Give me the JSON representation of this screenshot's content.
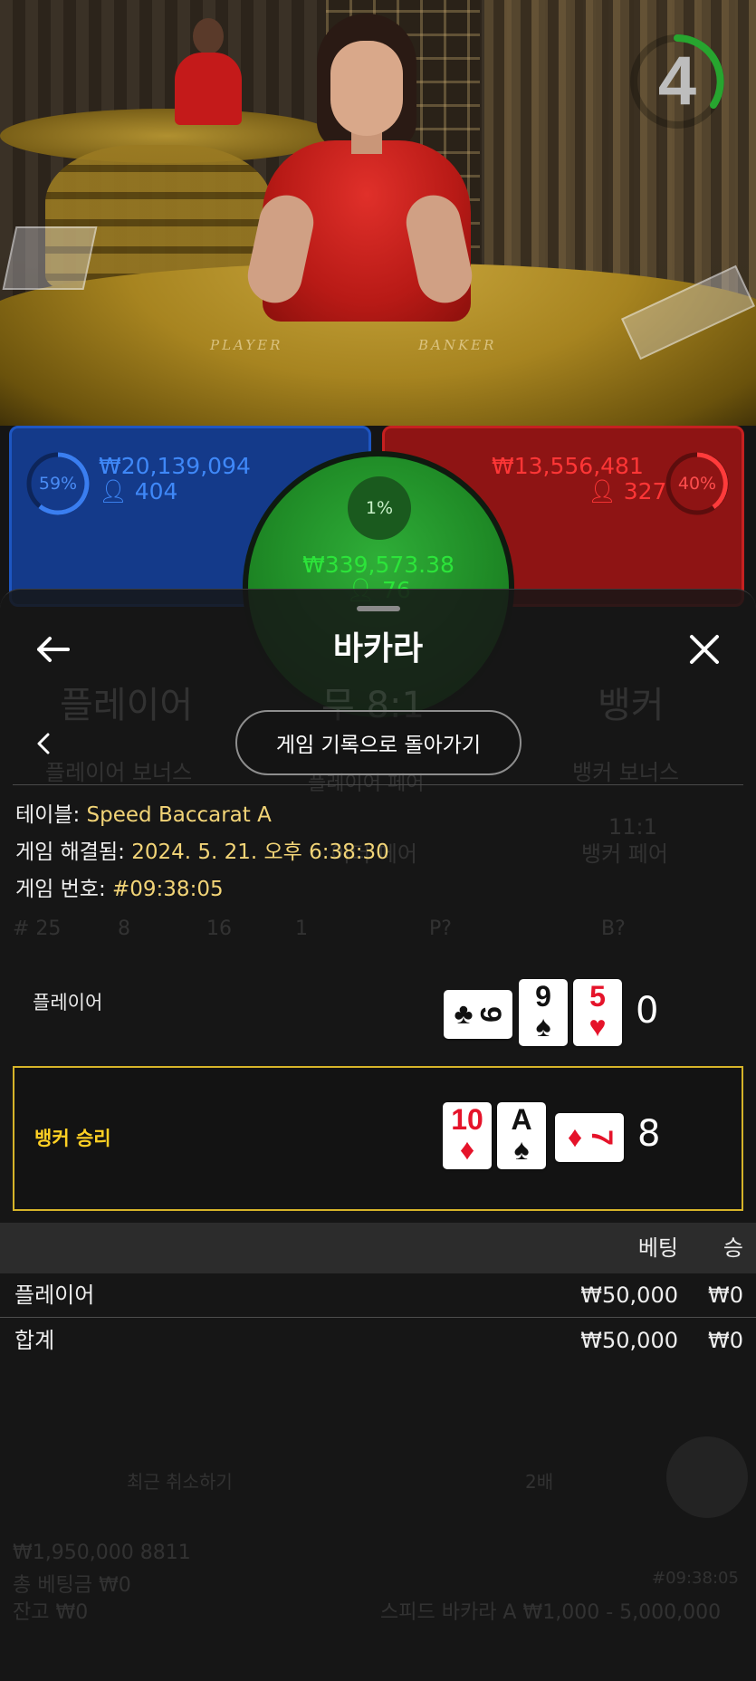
{
  "timer": {
    "value": "4",
    "ring_color": "#27a52f"
  },
  "video": {
    "table_labels": [
      "PLAYER",
      "BANKER"
    ]
  },
  "bets": {
    "player": {
      "percent": "59%",
      "amount": "₩20,139,094",
      "count": "404",
      "color": "#1f5fd0"
    },
    "banker": {
      "percent": "40%",
      "amount": "₩13,556,481",
      "count": "327",
      "color": "#d21f1f"
    },
    "tie": {
      "percent": "1%",
      "amount": "₩339,573.38",
      "count": "76",
      "color": "#2ce43a"
    }
  },
  "background": {
    "player_label": "플레이어",
    "tie_label": "무 8:1",
    "banker_label": "뱅커",
    "player_bonus": "플레이어 보너스",
    "player_pair": "플레이어 페어",
    "banker_bonus": "뱅커 보너스",
    "either_pair": "이더 페어",
    "banker_pair_odds": "11:1",
    "banker_pair": "뱅커 페어",
    "road_stats": [
      "# 25",
      "8",
      "16",
      "1",
      "P?",
      "B?"
    ],
    "balance_line": "₩1,950,000 8811",
    "total_bet": "총 베팅금 ₩0",
    "balance": "잔고 ₩0",
    "table_info": "스피드 바카라 A ₩1,000 - 5,000,000",
    "undo": "최근 취소하기",
    "repeat": "2배",
    "timestamp": "#09:38:05"
  },
  "sheet": {
    "title": "바카라",
    "back_button": "게임 기록으로 돌아가기",
    "info": {
      "table_label": "테이블:",
      "table_value": "Speed Baccarat A",
      "resolved_label": "게임 해결됨:",
      "resolved_value": "2024. 5. 21. 오후 6:38:30",
      "number_label": "게임 번호:",
      "number_value": "#09:38:05"
    },
    "hands": {
      "player": {
        "label": "플레이어",
        "total": "0",
        "cards": [
          {
            "rank": "9",
            "suit": "♣",
            "color": "black",
            "sideways": true
          },
          {
            "rank": "9",
            "suit": "♠",
            "color": "black",
            "sideways": false
          },
          {
            "rank": "5",
            "suit": "♥",
            "color": "red",
            "sideways": false
          }
        ]
      },
      "banker": {
        "label": "뱅커 승리",
        "total": "8",
        "cards": [
          {
            "rank": "10",
            "suit": "♦",
            "color": "red",
            "sideways": false
          },
          {
            "rank": "A",
            "suit": "♠",
            "color": "black",
            "sideways": false
          },
          {
            "rank": "7",
            "suit": "♦",
            "color": "red",
            "sideways": true
          }
        ]
      }
    },
    "results": {
      "headers": {
        "bet": "베팅",
        "win": "승"
      },
      "rows": [
        {
          "name": "플레이어",
          "bet": "₩50,000",
          "win": "₩0"
        },
        {
          "name": "합계",
          "bet": "₩50,000",
          "win": "₩0"
        }
      ]
    }
  }
}
